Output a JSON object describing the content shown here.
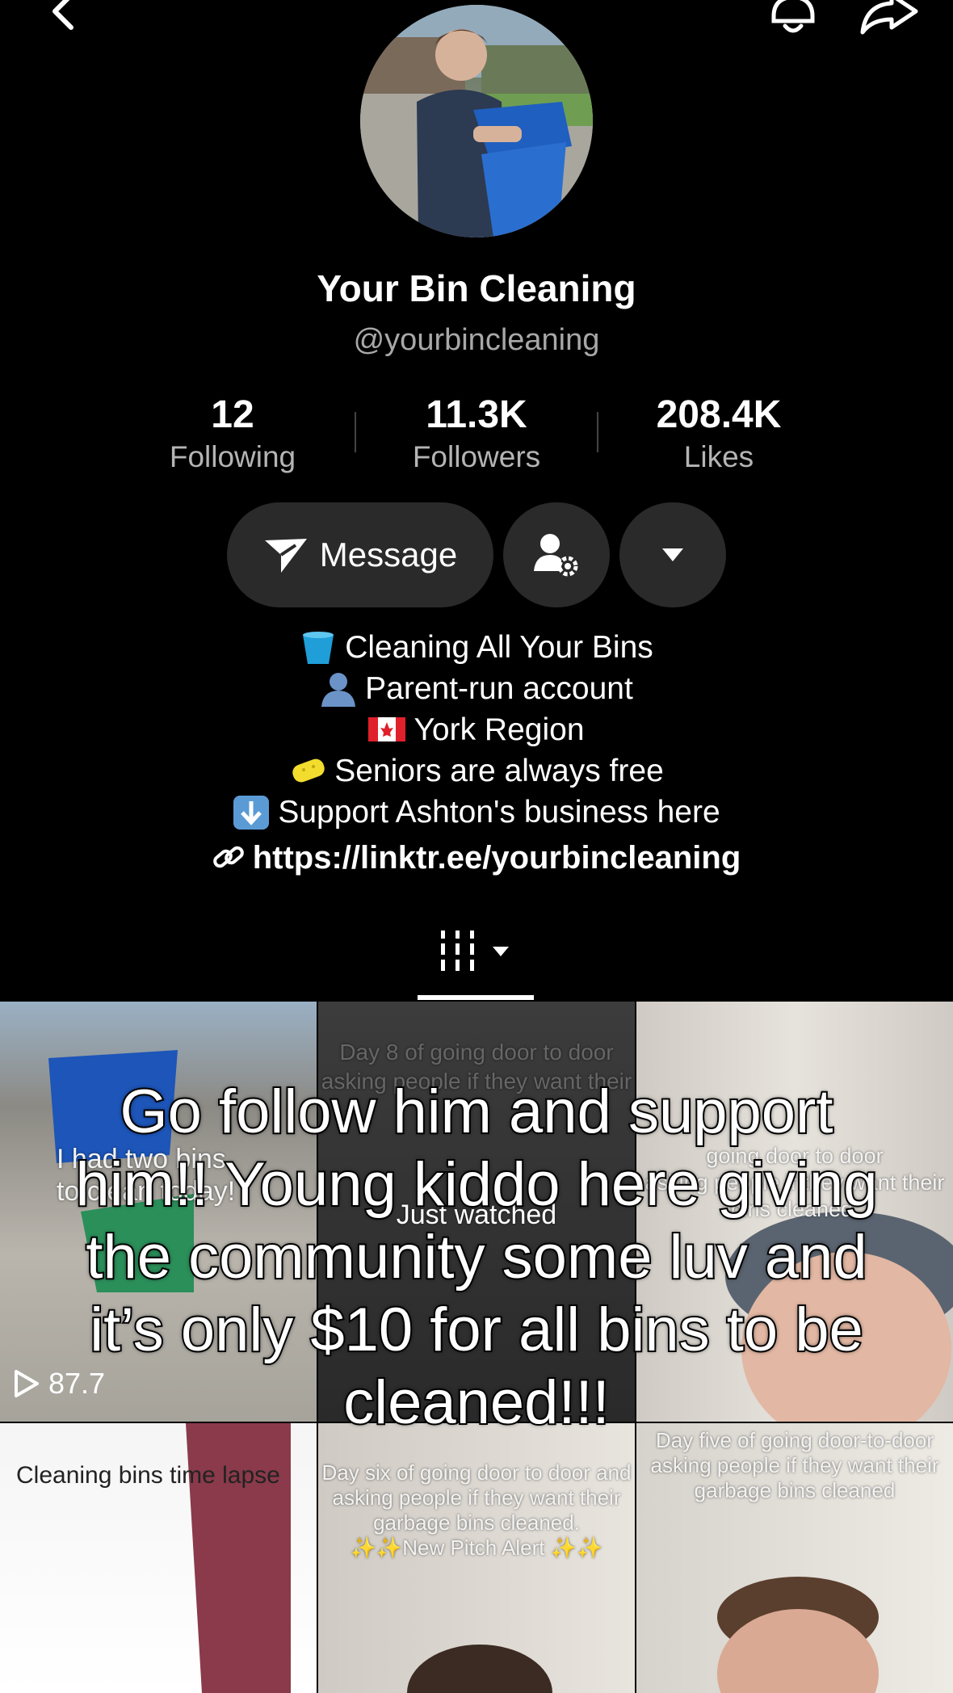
{
  "icons": {
    "back": "chevron-left-icon",
    "bell": "bell-icon",
    "share": "share-icon",
    "message": "send-icon",
    "friend_settings": "person-gear-icon",
    "more": "caret-down-icon",
    "link": "link-icon",
    "grid_tab": "grid-bars-icon",
    "play": "play-icon"
  },
  "profile": {
    "name": "Your Bin Cleaning",
    "handle": "@yourbincleaning"
  },
  "stats": [
    {
      "value": "12",
      "label": "Following"
    },
    {
      "value": "11.3K",
      "label": "Followers"
    },
    {
      "value": "208.4K",
      "label": "Likes"
    }
  ],
  "buttons": {
    "message": "Message"
  },
  "bio": {
    "lines": [
      {
        "emoji": "bucket",
        "text": "Cleaning All Your Bins"
      },
      {
        "emoji": "silhouette",
        "text": "Parent-run account"
      },
      {
        "emoji": "canada-flag",
        "text": "York Region"
      },
      {
        "emoji": "sponge",
        "text": "Seniors are always free"
      },
      {
        "emoji": "down-arrow",
        "text": "Support Ashton's business here"
      }
    ],
    "link": "https://linktr.ee/yourbincleaning"
  },
  "videos": [
    {
      "caption": "I had two bins\nto clean today!",
      "plays": "87.7"
    },
    {
      "caption": "Day 8 of going door to door\nasking people if they want their",
      "badge": "Just watched",
      "plays": ""
    },
    {
      "caption": "going door to door\nasking people if they want their\nbins cleaned.",
      "plays": ""
    },
    {
      "caption": "Cleaning bins time lapse"
    },
    {
      "caption": "Day six of going door to door and\nasking people if they want their\ngarbage bins cleaned.\n✨✨New Pitch Alert ✨✨"
    },
    {
      "caption": "Day five of going door-to-door\nasking people if they want their\ngarbage bins cleaned"
    }
  ],
  "overlay_caption": "Go follow him and support him!! Young kiddo here giving the community some luv and it’s only $10 for all bins to be cleaned!!!"
}
